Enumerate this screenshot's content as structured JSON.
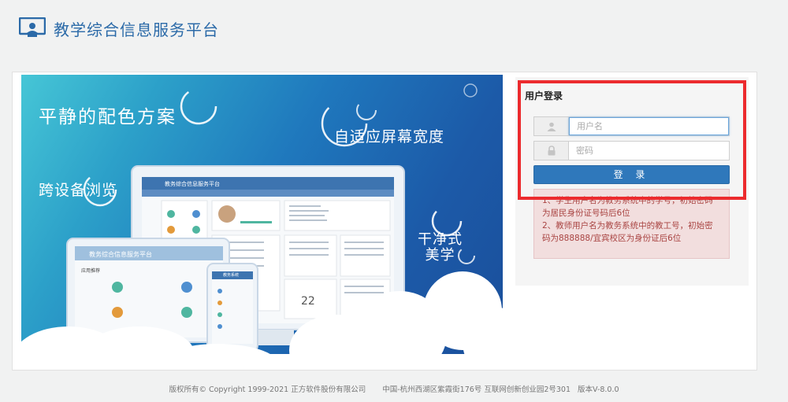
{
  "header": {
    "title": "教学综合信息服务平台",
    "logo_icon": "teacher-board-icon"
  },
  "banner": {
    "slogan_1": "平静的配色方案",
    "slogan_2": "自适应屏幕宽度",
    "slogan_3": "跨设备浏览",
    "slogan_4a": "干净式",
    "slogan_4b": "美学",
    "monitor_title": "教务综合信息服务平台",
    "tablet_title": "教务综合信息服务平台",
    "tablet_section": "应用推荐",
    "phone_title": "教务系统",
    "calendar_day": "22"
  },
  "login": {
    "title": "用户登录",
    "username_placeholder": "用户名",
    "password_placeholder": "密码",
    "username_icon": "user-icon",
    "password_icon": "lock-icon",
    "submit_label": "登 录",
    "notice_1": "1、学生用户名为教务系统中的学号，初始密码为居民身份证号码后6位",
    "notice_2": "2、教师用户名为教务系统中的教工号，初始密码为888888/宜宾校区为身份证后6位"
  },
  "footer": {
    "copyright": "版权所有© Copyright 1999-2021 正方软件股份有限公司",
    "address": "中国-杭州西湖区紫霞街176号 互联网创新创业园2号301",
    "version": "版本V-8.0.0"
  },
  "colors": {
    "brand": "#2b6aa8",
    "button": "#2f78bb",
    "notice_bg": "#f2dede",
    "notice_text": "#a94442",
    "highlight": "#ec2b2e"
  }
}
